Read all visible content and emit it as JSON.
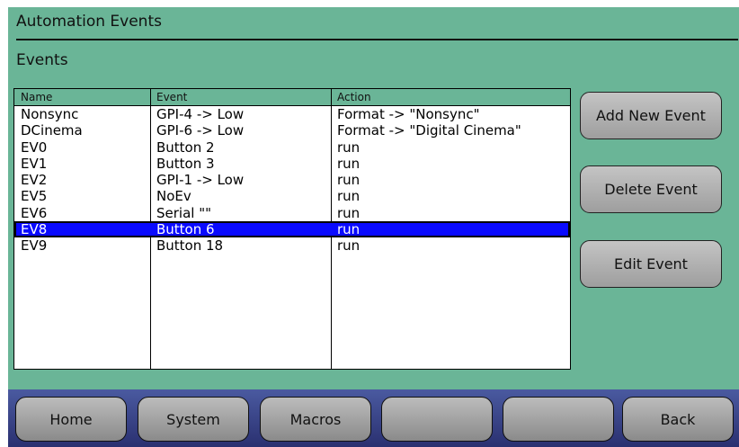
{
  "header": {
    "title": "Automation Events",
    "section": "Events"
  },
  "table": {
    "columns": [
      "Name",
      "Event",
      "Action"
    ],
    "rows": [
      {
        "name": "Nonsync",
        "event": "GPI-4 -> Low",
        "action": "Format -> \"Nonsync\""
      },
      {
        "name": "DCinema",
        "event": "GPI-6 -> Low",
        "action": "Format -> \"Digital Cinema\""
      },
      {
        "name": "EV0",
        "event": "Button 2",
        "action": "run"
      },
      {
        "name": "EV1",
        "event": "Button 3",
        "action": "run"
      },
      {
        "name": "EV2",
        "event": "GPI-1 -> Low",
        "action": "run"
      },
      {
        "name": "EV5",
        "event": "NoEv",
        "action": "run"
      },
      {
        "name": "EV6",
        "event": "Serial \"\"",
        "action": "run"
      },
      {
        "name": "EV8",
        "event": "Button 6",
        "action": "run"
      },
      {
        "name": "EV9",
        "event": "Button 18",
        "action": "run"
      }
    ],
    "selected_index": 7
  },
  "side_buttons": {
    "add": "Add New Event",
    "delete": "Delete Event",
    "edit": "Edit Event"
  },
  "bottom_nav": {
    "home": "Home",
    "system": "System",
    "macros": "Macros",
    "blank1": "",
    "blank2": "",
    "back": "Back"
  },
  "colors": {
    "panel_bg": "#6ab597",
    "selection": "#0a0aff",
    "bottom_bar": "#3a4488"
  }
}
